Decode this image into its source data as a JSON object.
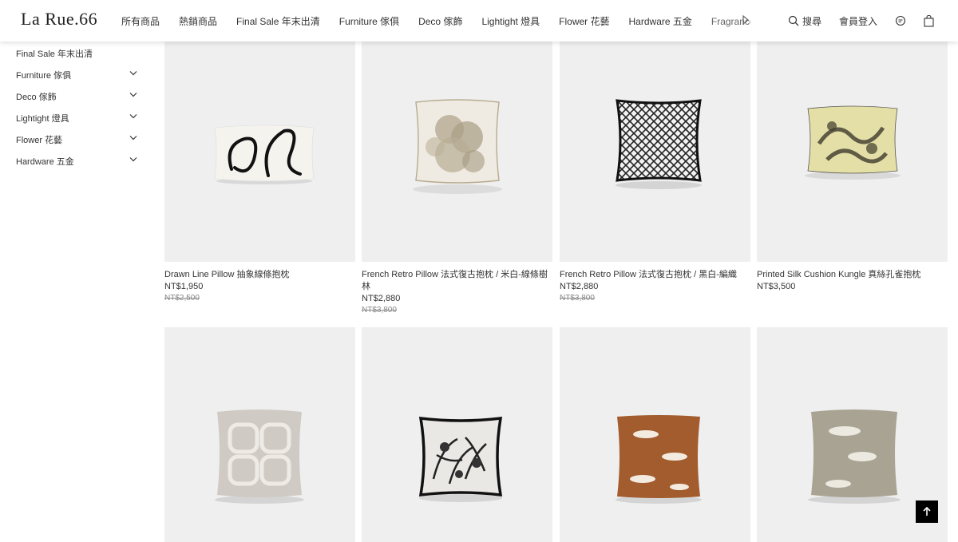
{
  "header": {
    "logo": "La Rue.66",
    "nav": [
      "所有商品",
      "熱銷商品",
      "Final Sale 年末出清",
      "Furniture 傢俱",
      "Deco 傢飾",
      "Lightight 燈具",
      "Flower 花藝",
      "Hardware 五金",
      "Fragrance 香氛"
    ],
    "search_label": "搜尋",
    "login_label": "會員登入"
  },
  "sidebar": {
    "items": [
      {
        "label": "Final Sale 年末出清",
        "expandable": false
      },
      {
        "label": "Furniture 傢俱",
        "expandable": true
      },
      {
        "label": "Deco 傢飾",
        "expandable": true
      },
      {
        "label": "Lightight 燈具",
        "expandable": true
      },
      {
        "label": "Flower 花藝",
        "expandable": true
      },
      {
        "label": "Hardware 五金",
        "expandable": true
      }
    ]
  },
  "products": [
    {
      "name": "Drawn Line Pillow 抽象線條抱枕",
      "price": "NT$1,950",
      "old_price": "NT$2,500"
    },
    {
      "name": "French Retro Pillow 法式復古抱枕 / 米白-線條樹林",
      "price": "NT$2,880",
      "old_price": "NT$3,800"
    },
    {
      "name": "French Retro Pillow 法式復古抱枕 / 黑白-編織",
      "price": "NT$2,880",
      "old_price": "NT$3,800"
    },
    {
      "name": "Printed Silk Cushion Kungle 真絲孔雀抱枕",
      "price": "NT$3,500",
      "old_price": ""
    },
    {
      "name": "",
      "price": "",
      "old_price": ""
    },
    {
      "name": "",
      "price": "",
      "old_price": ""
    },
    {
      "name": "",
      "price": "",
      "old_price": ""
    },
    {
      "name": "",
      "price": "",
      "old_price": ""
    }
  ],
  "icons": {
    "search": "search-icon",
    "chat": "chat-icon",
    "cart": "shopping-bag-icon",
    "back_to_top": "arrow-up-icon",
    "chevron": "chevron-down-icon"
  },
  "colors": {
    "header_bg": "#ffffff",
    "card_bg": "#efefef",
    "back_to_top_bg": "#000000"
  }
}
